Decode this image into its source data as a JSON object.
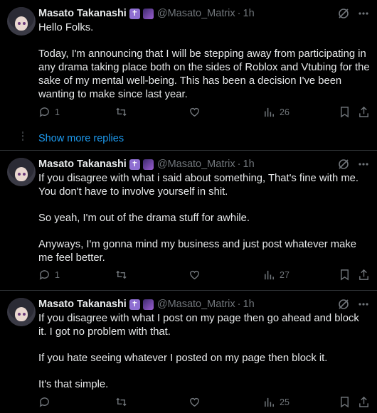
{
  "show_more": "Show more replies",
  "tweets": [
    {
      "name": "Masato Takanashi",
      "badges": [
        "cross-badge",
        "galaxy-badge"
      ],
      "handle": "@Masato_Matrix",
      "dot": "·",
      "time": "1h",
      "paragraphs": [
        "Hello Folks.",
        "Today, I'm announcing that I will be stepping away from participating in any drama taking place both on the sides of Roblox and Vtubing for the sake of my mental well-being. This has been a decision I've been wanting to make since last year."
      ],
      "reply_count": "1",
      "retweet_count": "",
      "like_count": "",
      "views": "26"
    },
    {
      "name": "Masato Takanashi",
      "badges": [
        "cross-badge",
        "galaxy-badge"
      ],
      "handle": "@Masato_Matrix",
      "dot": "·",
      "time": "1h",
      "paragraphs": [
        "If you disagree with what i said about something, That's fine with me. You don't have to involve yourself in shit.",
        "So yeah, I'm out of the drama stuff for awhile.",
        "Anyways, I'm gonna mind my business and just post whatever make me feel better."
      ],
      "reply_count": "1",
      "retweet_count": "",
      "like_count": "",
      "views": "27"
    },
    {
      "name": "Masato Takanashi",
      "badges": [
        "cross-badge",
        "galaxy-badge"
      ],
      "handle": "@Masato_Matrix",
      "dot": "·",
      "time": "1h",
      "paragraphs": [
        "If you disagree with what I post on my page then go ahead and block it. I got no problem with that.",
        "If you hate seeing whatever I posted on my page then block it.",
        "It's that simple."
      ],
      "reply_count": "",
      "retweet_count": "",
      "like_count": "",
      "views": "25"
    }
  ],
  "colors": {
    "background": "#000000",
    "text": "#e7e9ea",
    "muted": "#71767b",
    "link": "#1d9bf0"
  }
}
